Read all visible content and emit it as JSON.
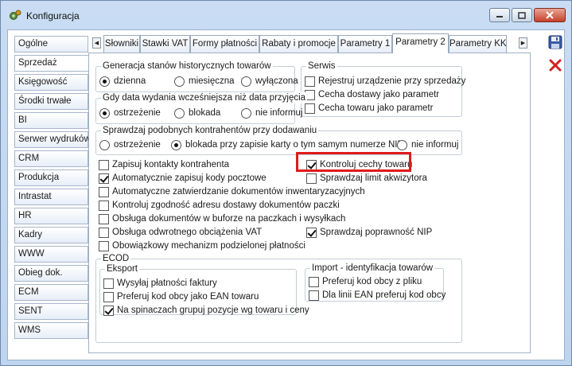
{
  "window": {
    "title": "Konfiguracja"
  },
  "nav": {
    "items": [
      "Ogólne",
      "Sprzedaż",
      "Księgowość",
      "Środki trwałe",
      "BI",
      "Serwer wydruków",
      "CRM",
      "Produkcja",
      "Intrastat",
      "HR",
      "Kadry",
      "WWW",
      "Obieg dok.",
      "ECM",
      "SENT",
      "WMS"
    ],
    "active": "Sprzedaż"
  },
  "tabs": {
    "items": [
      "Słowniki",
      "Stawki VAT",
      "Formy płatności",
      "Rabaty i promocje",
      "Parametry 1",
      "Parametry 2",
      "Parametry KK"
    ],
    "active": "Parametry 2"
  },
  "historyczne": {
    "title": "Generacja stanów historycznych towarów",
    "options": [
      "dzienna",
      "miesięczna",
      "wyłączona"
    ],
    "selected": "dzienna"
  },
  "serwis": {
    "title": "Serwis",
    "items": [
      {
        "label": "Rejestruj urządzenie przy sprzedaży",
        "checked": false
      },
      {
        "label": "Cecha dostawy jako parametr",
        "checked": false
      },
      {
        "label": "Cecha towaru jako parametr",
        "checked": false
      }
    ]
  },
  "data_wydania": {
    "title": "Gdy data wydania wcześniejsza niż data przyjęcia",
    "options": [
      "ostrzeżenie",
      "blokada",
      "nie informuj"
    ],
    "selected": "ostrzeżenie"
  },
  "kontrahenci": {
    "title": "Sprawdzaj podobnych kontrahentów przy dodawaniu",
    "options": [
      "ostrzeżenie",
      "blokada przy zapisie karty o tym samym numerze NIP",
      "nie informuj"
    ],
    "selected": "blokada przy zapisie karty o tym samym numerze NIP"
  },
  "checkboxes_left": [
    {
      "label": "Zapisuj kontakty kontrahenta",
      "checked": false
    },
    {
      "label": "Automatycznie zapisuj kody pocztowe",
      "checked": true
    },
    {
      "label": "Automatyczne zatwierdzanie dokumentów inwentaryzacyjnych",
      "checked": false
    },
    {
      "label": "Kontroluj zgodność adresu dostawy dokumentów paczki",
      "checked": false
    },
    {
      "label": "Obsługa dokumentów w buforze na paczkach i wysyłkach",
      "checked": false
    },
    {
      "label": "Obsługa odwrotnego obciążenia VAT",
      "checked": false
    },
    {
      "label": "Obowiązkowy mechanizm podzielonej płatności",
      "checked": false
    }
  ],
  "checkboxes_right": [
    {
      "label": "Kontroluj cechy towaru",
      "checked": true
    },
    {
      "label": "Sprawdzaj limit akwizytora",
      "checked": false
    },
    {
      "label": "Sprawdzaj poprawność NIP",
      "checked": true
    }
  ],
  "ecod": {
    "title": "ECOD",
    "eksport": {
      "title": "Eksport",
      "items": [
        {
          "label": "Wysyłaj płatności faktury",
          "checked": false
        },
        {
          "label": "Preferuj kod obcy jako EAN towaru",
          "checked": false
        },
        {
          "label": "Na spinaczach grupuj pozycje wg towaru i ceny",
          "checked": true
        }
      ]
    },
    "import": {
      "title": "Import - identyfikacja towarów",
      "items": [
        {
          "label": "Preferuj kod obcy z pliku",
          "checked": false
        },
        {
          "label": "Dla linii EAN preferuj kod obcy",
          "checked": false
        }
      ]
    }
  },
  "colors": {
    "highlight": "#e01b1b",
    "save": "#3a5aa8",
    "cancel": "#d42020"
  },
  "icons": [
    "app-icon",
    "minimize-icon",
    "maximize-icon",
    "close-icon",
    "save-icon",
    "cancel-icon",
    "arrow-left-icon",
    "arrow-right-icon"
  ]
}
